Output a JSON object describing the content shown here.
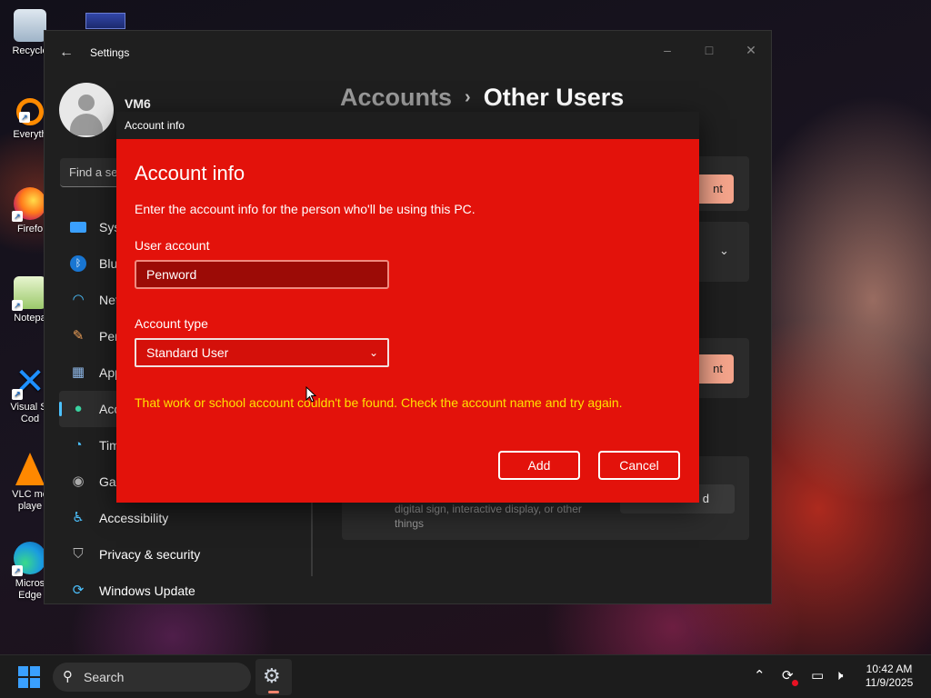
{
  "desktop": {
    "icons": [
      {
        "label": "Recycle",
        "icon": "recycle-bin-icon"
      },
      {
        "label": "Everyth",
        "icon": "everything-search-icon"
      },
      {
        "label": "Firefo",
        "icon": "firefox-icon"
      },
      {
        "label": "Notepa",
        "icon": "notepad-icon"
      },
      {
        "label": "Visual St\nCod",
        "icon": "vscode-icon"
      },
      {
        "label": "VLC me\nplaye",
        "icon": "vlc-icon"
      },
      {
        "label": "Micros\nEdge",
        "icon": "edge-icon"
      }
    ]
  },
  "settings": {
    "title": "Settings",
    "user_name": "VM6",
    "search_placeholder": "Find a se",
    "breadcrumb": {
      "parent": "Accounts",
      "separator": "›",
      "current": "Other Users"
    },
    "nav": [
      {
        "label": "Sys",
        "icon": "system-icon"
      },
      {
        "label": "Blu",
        "icon": "bluetooth-icon"
      },
      {
        "label": "Net",
        "icon": "network-icon"
      },
      {
        "label": "Per",
        "icon": "personalization-icon"
      },
      {
        "label": "App",
        "icon": "apps-icon"
      },
      {
        "label": "Acc",
        "icon": "accounts-icon",
        "active": true
      },
      {
        "label": "Tim",
        "icon": "time-language-icon"
      },
      {
        "label": "Gar",
        "icon": "gaming-icon"
      },
      {
        "label": "Accessibility",
        "icon": "accessibility-icon"
      },
      {
        "label": "Privacy & security",
        "icon": "privacy-shield-icon"
      },
      {
        "label": "Windows Update",
        "icon": "windows-update-icon"
      }
    ],
    "peek": {
      "button1": "nt",
      "button2": "nt",
      "card_desc": "digital sign, interactive display, or other things",
      "card_button": "d"
    }
  },
  "dialog": {
    "window_title": "Account info",
    "heading": "Account info",
    "description": "Enter the account info for the person who'll be using this PC.",
    "user_account_label": "User account",
    "user_account_value": "Penword",
    "account_type_label": "Account type",
    "account_type_value": "Standard User",
    "error": "That work or school account couldn't be found. Check the account name and try again.",
    "add_button": "Add",
    "cancel_button": "Cancel",
    "colors": {
      "background": "#e3120b",
      "error_text": "#ffe100"
    }
  },
  "taskbar": {
    "search_label": "Search",
    "time": "10:42 AM",
    "date": "11/9/2025"
  }
}
